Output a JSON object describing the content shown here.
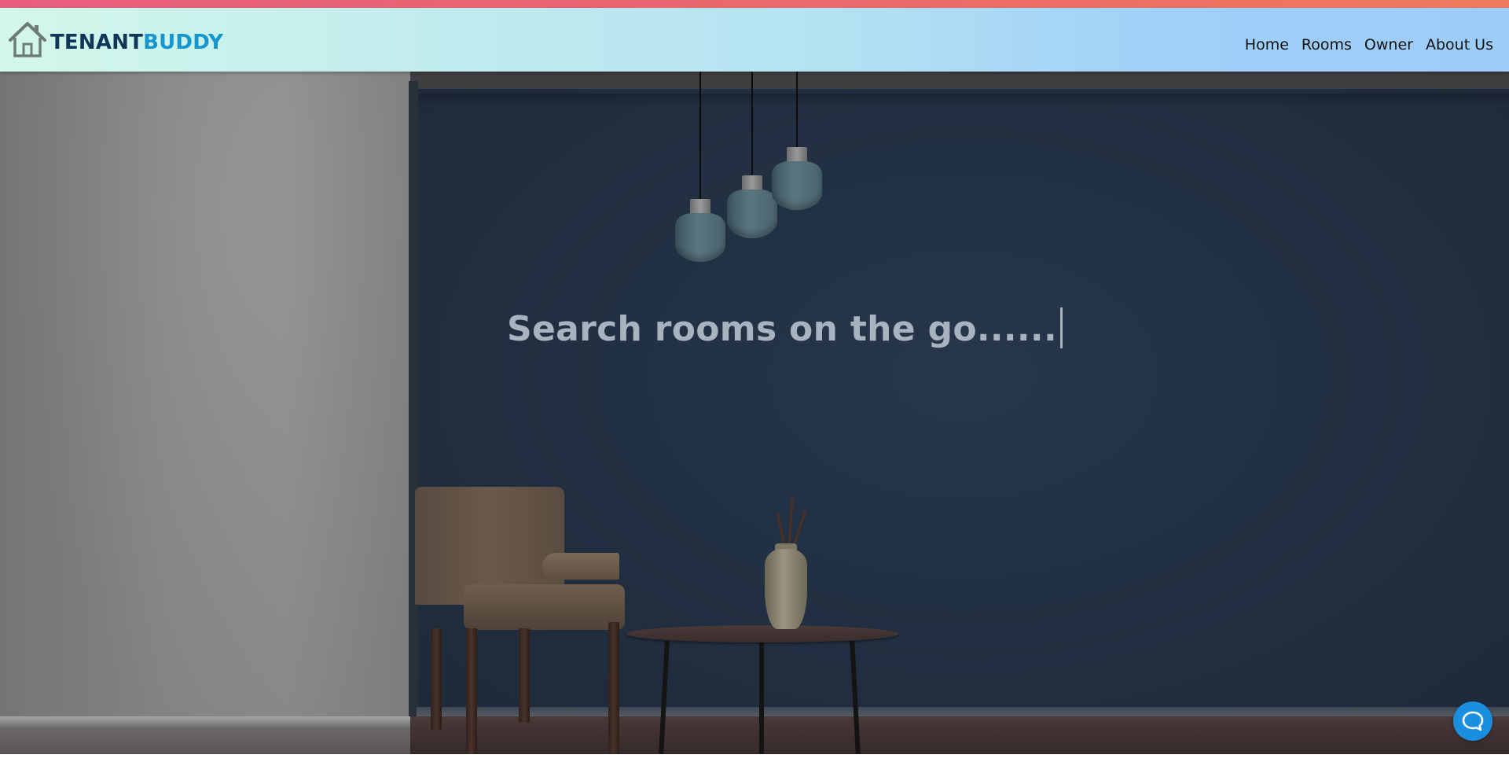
{
  "brand": {
    "part1": "TENANT",
    "part2": "BUDDY",
    "icon": "house-icon"
  },
  "nav": {
    "items": [
      {
        "label": "Home"
      },
      {
        "label": "Rooms"
      },
      {
        "label": "Owner"
      },
      {
        "label": "About Us"
      }
    ]
  },
  "hero": {
    "caption": "Search rooms on the go......"
  },
  "chat": {
    "icon": "chat-bubble-icon"
  },
  "colors": {
    "brand_dark": "#0f3657",
    "brand_accent": "#1696cf",
    "top_stripe": "#e85d7e",
    "chat_button": "#1a8fe0"
  }
}
